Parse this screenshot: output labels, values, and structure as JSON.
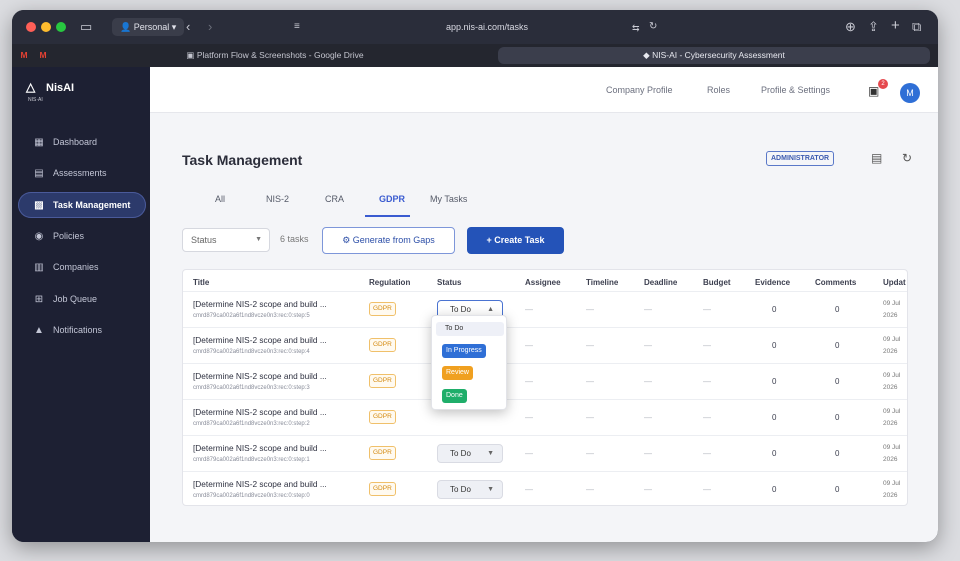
{
  "browser": {
    "profile": "Personal",
    "url": "app.nis-ai.com/tasks",
    "tabs": [
      {
        "label": "Platform Flow & Screenshots - Google Drive"
      },
      {
        "label": "NIS-AI - Cybersecurity Assessment"
      }
    ]
  },
  "sidebar": {
    "logo": "NisAI",
    "logo_sub": "NIS·AI",
    "items": [
      {
        "label": "Dashboard",
        "icon": "dashboard-icon"
      },
      {
        "label": "Assessments",
        "icon": "clipboard-icon"
      },
      {
        "label": "Task Management",
        "icon": "task-icon"
      },
      {
        "label": "Policies",
        "icon": "policy-icon"
      },
      {
        "label": "Companies",
        "icon": "building-icon"
      },
      {
        "label": "Job Queue",
        "icon": "queue-icon"
      },
      {
        "label": "Notifications",
        "icon": "bell-icon"
      }
    ],
    "active_index": 2
  },
  "topnav": {
    "links": [
      "Company Profile",
      "Roles",
      "Profile & Settings"
    ],
    "notification_count": "2",
    "avatar": "M"
  },
  "page": {
    "title": "Task Management",
    "role_badge": "ADMINISTRATOR",
    "tabs": [
      "All",
      "NIS-2",
      "CRA",
      "GDPR",
      "My Tasks"
    ],
    "active_tab": "GDPR",
    "status_filter": "Status",
    "task_count": "6 tasks",
    "generate_label": "Generate from Gaps",
    "create_label": "+ Create Task"
  },
  "table": {
    "columns": [
      "Title",
      "Regulation",
      "Status",
      "Assignee",
      "Timeline",
      "Deadline",
      "Budget",
      "Evidence",
      "Comments",
      "Updat"
    ],
    "rows": [
      {
        "title": "[Determine NIS-2 scope and build ...",
        "id": "cmrd879ca002a6f1nd8vcze0n3:rec:0:step:5",
        "regulation": "GDPR",
        "status": "To Do",
        "assignee": "—",
        "timeline": "—",
        "deadline": "—",
        "budget": "—",
        "evidence": "0",
        "comments": "0",
        "updated_1": "09 Jul",
        "updated_2": "2026"
      },
      {
        "title": "[Determine NIS-2 scope and build ...",
        "id": "cmrd879ca002a6f1nd8vcze0n3:rec:0:step:4",
        "regulation": "GDPR",
        "status": "",
        "assignee": "—",
        "timeline": "—",
        "deadline": "—",
        "budget": "—",
        "evidence": "0",
        "comments": "0",
        "updated_1": "09 Jul",
        "updated_2": "2026"
      },
      {
        "title": "[Determine NIS-2 scope and build ...",
        "id": "cmrd879ca002a6f1nd8vcze0n3:rec:0:step:3",
        "regulation": "GDPR",
        "status": "",
        "assignee": "—",
        "timeline": "—",
        "deadline": "—",
        "budget": "—",
        "evidence": "0",
        "comments": "0",
        "updated_1": "09 Jul",
        "updated_2": "2026"
      },
      {
        "title": "[Determine NIS-2 scope and build ...",
        "id": "cmrd879ca002a6f1nd8vcze0n3:rec:0:step:2",
        "regulation": "GDPR",
        "status": "",
        "assignee": "—",
        "timeline": "—",
        "deadline": "—",
        "budget": "—",
        "evidence": "0",
        "comments": "0",
        "updated_1": "09 Jul",
        "updated_2": "2026"
      },
      {
        "title": "[Determine NIS-2 scope and build ...",
        "id": "cmrd879ca002a6f1nd8vcze0n3:rec:0:step:1",
        "regulation": "GDPR",
        "status": "To Do",
        "assignee": "—",
        "timeline": "—",
        "deadline": "—",
        "budget": "—",
        "evidence": "0",
        "comments": "0",
        "updated_1": "09 Jul",
        "updated_2": "2026"
      },
      {
        "title": "[Determine NIS-2 scope and build ...",
        "id": "cmrd879ca002a6f1nd8vcze0n3:rec:0:step:0",
        "regulation": "GDPR",
        "status": "To Do",
        "assignee": "—",
        "timeline": "—",
        "deadline": "—",
        "budget": "—",
        "evidence": "0",
        "comments": "0",
        "updated_1": "09 Jul",
        "updated_2": "2026"
      }
    ]
  },
  "status_dropdown": {
    "options": [
      {
        "label": "To Do",
        "color": "#eef0f7"
      },
      {
        "label": "In Progress",
        "color": "#2f6fd6"
      },
      {
        "label": "Review",
        "color": "#f0a020"
      },
      {
        "label": "Done",
        "color": "#1fae6a"
      }
    ]
  },
  "colors": {
    "sidebar_bg": "#1d2033",
    "accent": "#2453b8",
    "regulation_badge": "#d48a10"
  }
}
